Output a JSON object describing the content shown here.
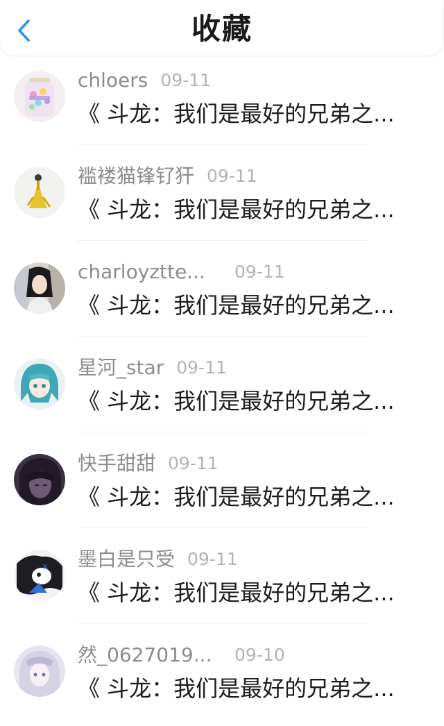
{
  "header": {
    "title": "收藏",
    "back_icon": "chevron-left-icon",
    "accent_color": "#2b8ff5"
  },
  "items": [
    {
      "username": "chloers",
      "date": "09-11",
      "title": "《 斗龙：我们是最好的兄弟之..."
    },
    {
      "username": "褴褛猫锋钌犴",
      "date": "09-11",
      "title": "《 斗龙：我们是最好的兄弟之..."
    },
    {
      "username": "charloyztte...",
      "date": "09-11",
      "title": "《 斗龙：我们是最好的兄弟之..."
    },
    {
      "username": "星河_star",
      "date": "09-11",
      "title": "《 斗龙：我们是最好的兄弟之..."
    },
    {
      "username": "快手甜甜",
      "date": "09-11",
      "title": "《 斗龙：我们是最好的兄弟之..."
    },
    {
      "username": "墨白是只受",
      "date": "09-11",
      "title": "《 斗龙：我们是最好的兄弟之..."
    },
    {
      "username": "然_0627019...",
      "date": "09-10",
      "title": "《 斗龙：我们是最好的兄弟之..."
    }
  ]
}
